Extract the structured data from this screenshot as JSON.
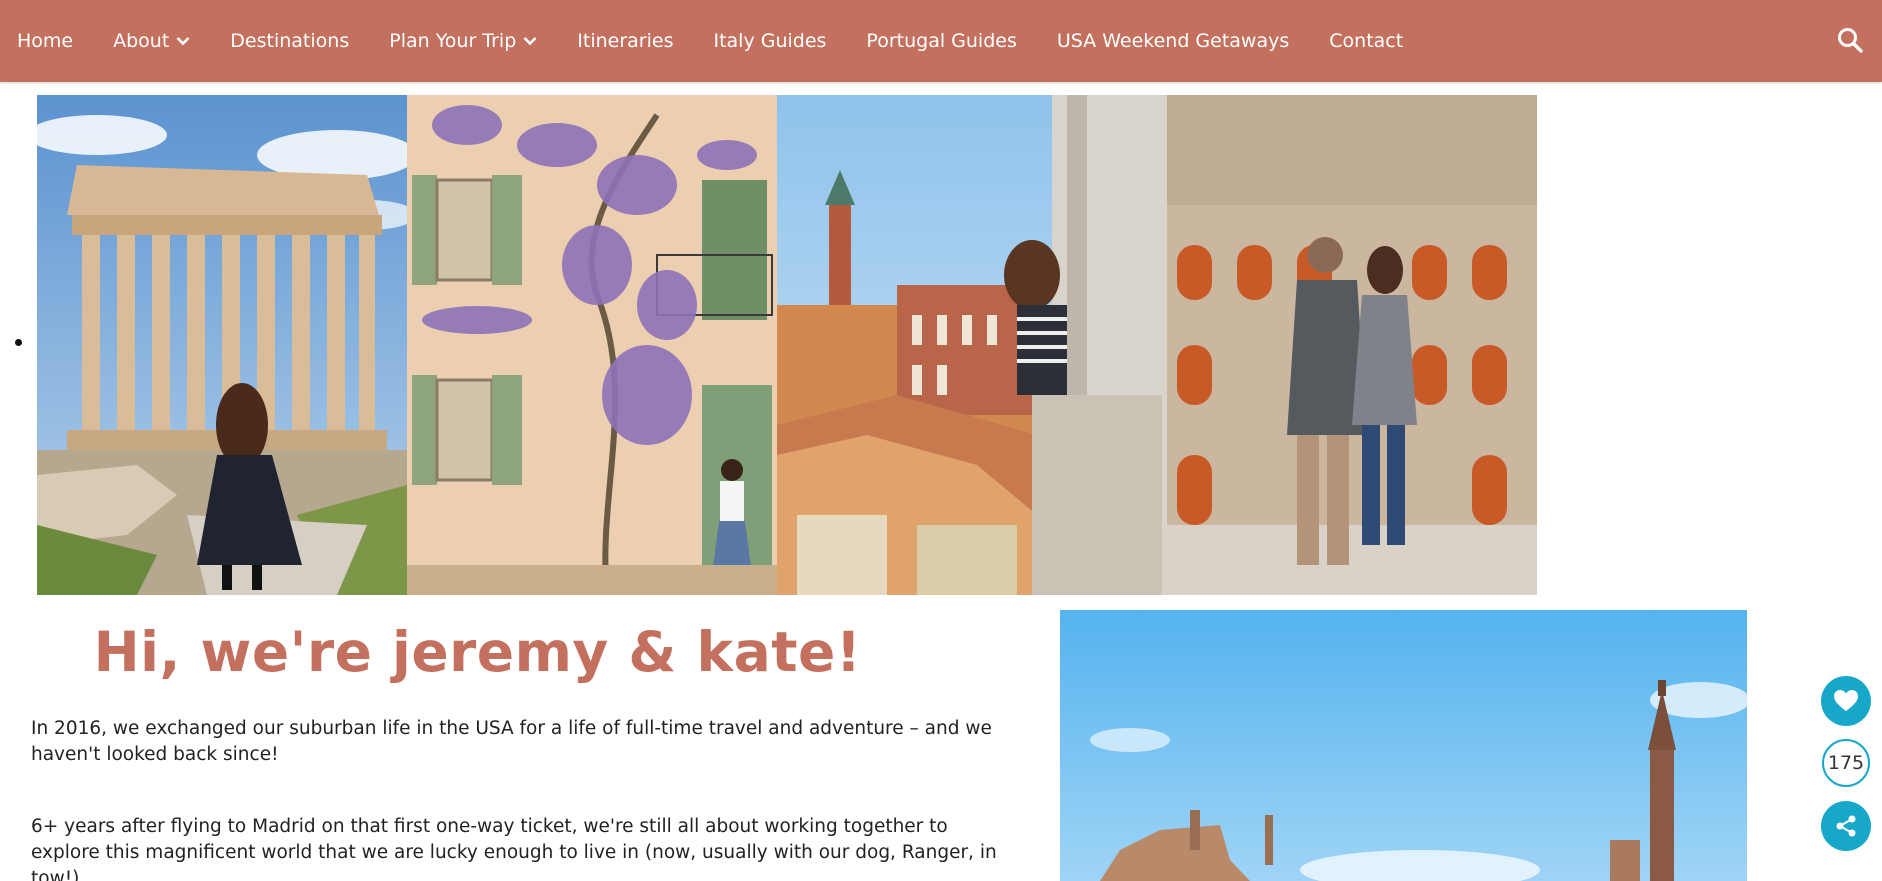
{
  "nav": {
    "items": [
      {
        "label": "Home",
        "has_dropdown": false
      },
      {
        "label": "About",
        "has_dropdown": true
      },
      {
        "label": "Destinations",
        "has_dropdown": false
      },
      {
        "label": "Plan Your Trip",
        "has_dropdown": true
      },
      {
        "label": "Itineraries",
        "has_dropdown": false
      },
      {
        "label": "Italy Guides",
        "has_dropdown": false
      },
      {
        "label": "Portugal Guides",
        "has_dropdown": false
      },
      {
        "label": "USA Weekend Getaways",
        "has_dropdown": false
      },
      {
        "label": "Contact",
        "has_dropdown": false
      }
    ],
    "search_icon": "search-icon",
    "background_color": "#c4705e"
  },
  "hero": {
    "panels": [
      "acropolis-photo",
      "wisteria-house-photo",
      "venice-rooftops-photo",
      "colosseum-couple-photo"
    ]
  },
  "intro": {
    "title": "Hi, we're jeremy & kate!",
    "paragraph_1": "In 2016, we exchanged our suburban life in the USA for a life of full-time travel and adventure – and we haven't looked back since!",
    "paragraph_2": "6+ years after flying to Madrid on that first one-way ticket, we're still all about working together to explore this magnificent world that we are lucky enough to live in (now, usually with our dog, Ranger, in tow!).",
    "title_color": "#c4705e"
  },
  "share": {
    "count": "175",
    "accent_color": "#17a8c9"
  }
}
